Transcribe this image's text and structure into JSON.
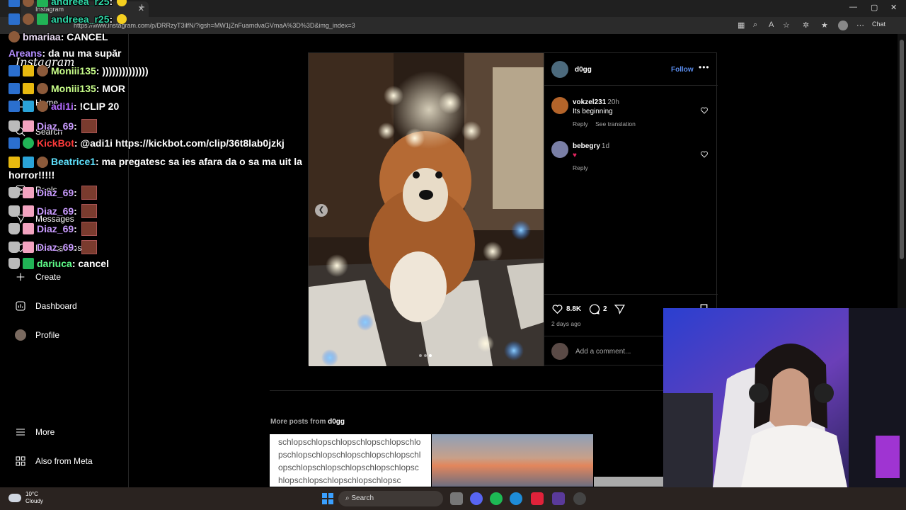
{
  "browser": {
    "tab_title": "Instagram",
    "url": "https://www.instagram.com/p/DRRzyT3ilfN/?igsh=MW1jZnFuamdvaGVmaA%3D%3D&img_index=3",
    "chat_label": "Chat"
  },
  "sidebar": {
    "logo": "Instagram",
    "items": [
      {
        "label": "Home"
      },
      {
        "label": "Search"
      },
      {
        "label": "Reels"
      },
      {
        "label": "Messages"
      },
      {
        "label": "Notifications"
      },
      {
        "label": "Create"
      },
      {
        "label": "Dashboard"
      },
      {
        "label": "Profile"
      },
      {
        "label": "More"
      },
      {
        "label": "Also from Meta"
      }
    ]
  },
  "post": {
    "username": "d0gg",
    "follow_label": "Follow",
    "comments": [
      {
        "user": "vokzel231",
        "time": "20h",
        "text": "Its beginning",
        "actions": [
          "Reply",
          "See translation"
        ]
      },
      {
        "user": "bebegry",
        "time": "1d",
        "text": "♥",
        "actions": [
          "Reply"
        ]
      }
    ],
    "likes": "8.8K",
    "comment_count": "2",
    "posted": "2 days ago",
    "add_comment_placeholder": "Add a comment...",
    "carousel": {
      "slide": 3,
      "of": 3
    }
  },
  "more_posts": {
    "prefix": "More posts from",
    "user": "d0gg",
    "thumb1_text": "schlopschlopschlopschlopschlopschlopschlopschlopschlopschlopschlopschlopschlopschlopschlopschlopschlopschlopschlopschlopschlopschlopsc"
  },
  "chat": [
    {
      "user": "andreea_r25",
      "color": "#2fd7a7",
      "text": ""
    },
    {
      "user": "andreea_r25",
      "color": "#2fd7a7",
      "text": ""
    },
    {
      "user": "bmariaa",
      "color": "#e8d9f2",
      "text": "CANCEL"
    },
    {
      "user": "Areans",
      "color": "#b28cff",
      "text": "da nu ma supăr"
    },
    {
      "user": "Moniii135",
      "color": "#c9ff8a",
      "text": "))))))))))))))"
    },
    {
      "user": "Moniii135",
      "color": "#c9ff8a",
      "text": "MOR"
    },
    {
      "user": "adi1i",
      "color": "#b46bff",
      "text": "!CLIP 20"
    },
    {
      "user": "Diaz_69",
      "color": "#c99bff",
      "text": ""
    },
    {
      "user": "KickBot",
      "color": "#ff3b3b",
      "text": "@adi1i https://kickbot.com/clip/36t8lab0jzkj"
    },
    {
      "user": "Beatrice1",
      "color": "#5fe3ff",
      "text": "ma pregatesc sa ies afara da o sa ma uit la horror!!!!!"
    },
    {
      "user": "Diaz_69",
      "color": "#c99bff",
      "text": ""
    },
    {
      "user": "Diaz_69",
      "color": "#c99bff",
      "text": ""
    },
    {
      "user": "Diaz_69",
      "color": "#c99bff",
      "text": ""
    },
    {
      "user": "Diaz_69",
      "color": "#c99bff",
      "text": ""
    },
    {
      "user": "dariuca",
      "color": "#5fff8a",
      "text": "cancel"
    }
  ],
  "taskbar": {
    "temp": "10°C",
    "condition": "Cloudy",
    "search": "Search"
  },
  "colors": {
    "ig_blue": "#5a8dee",
    "like_red": "#e0245e",
    "bg": "#000000"
  }
}
